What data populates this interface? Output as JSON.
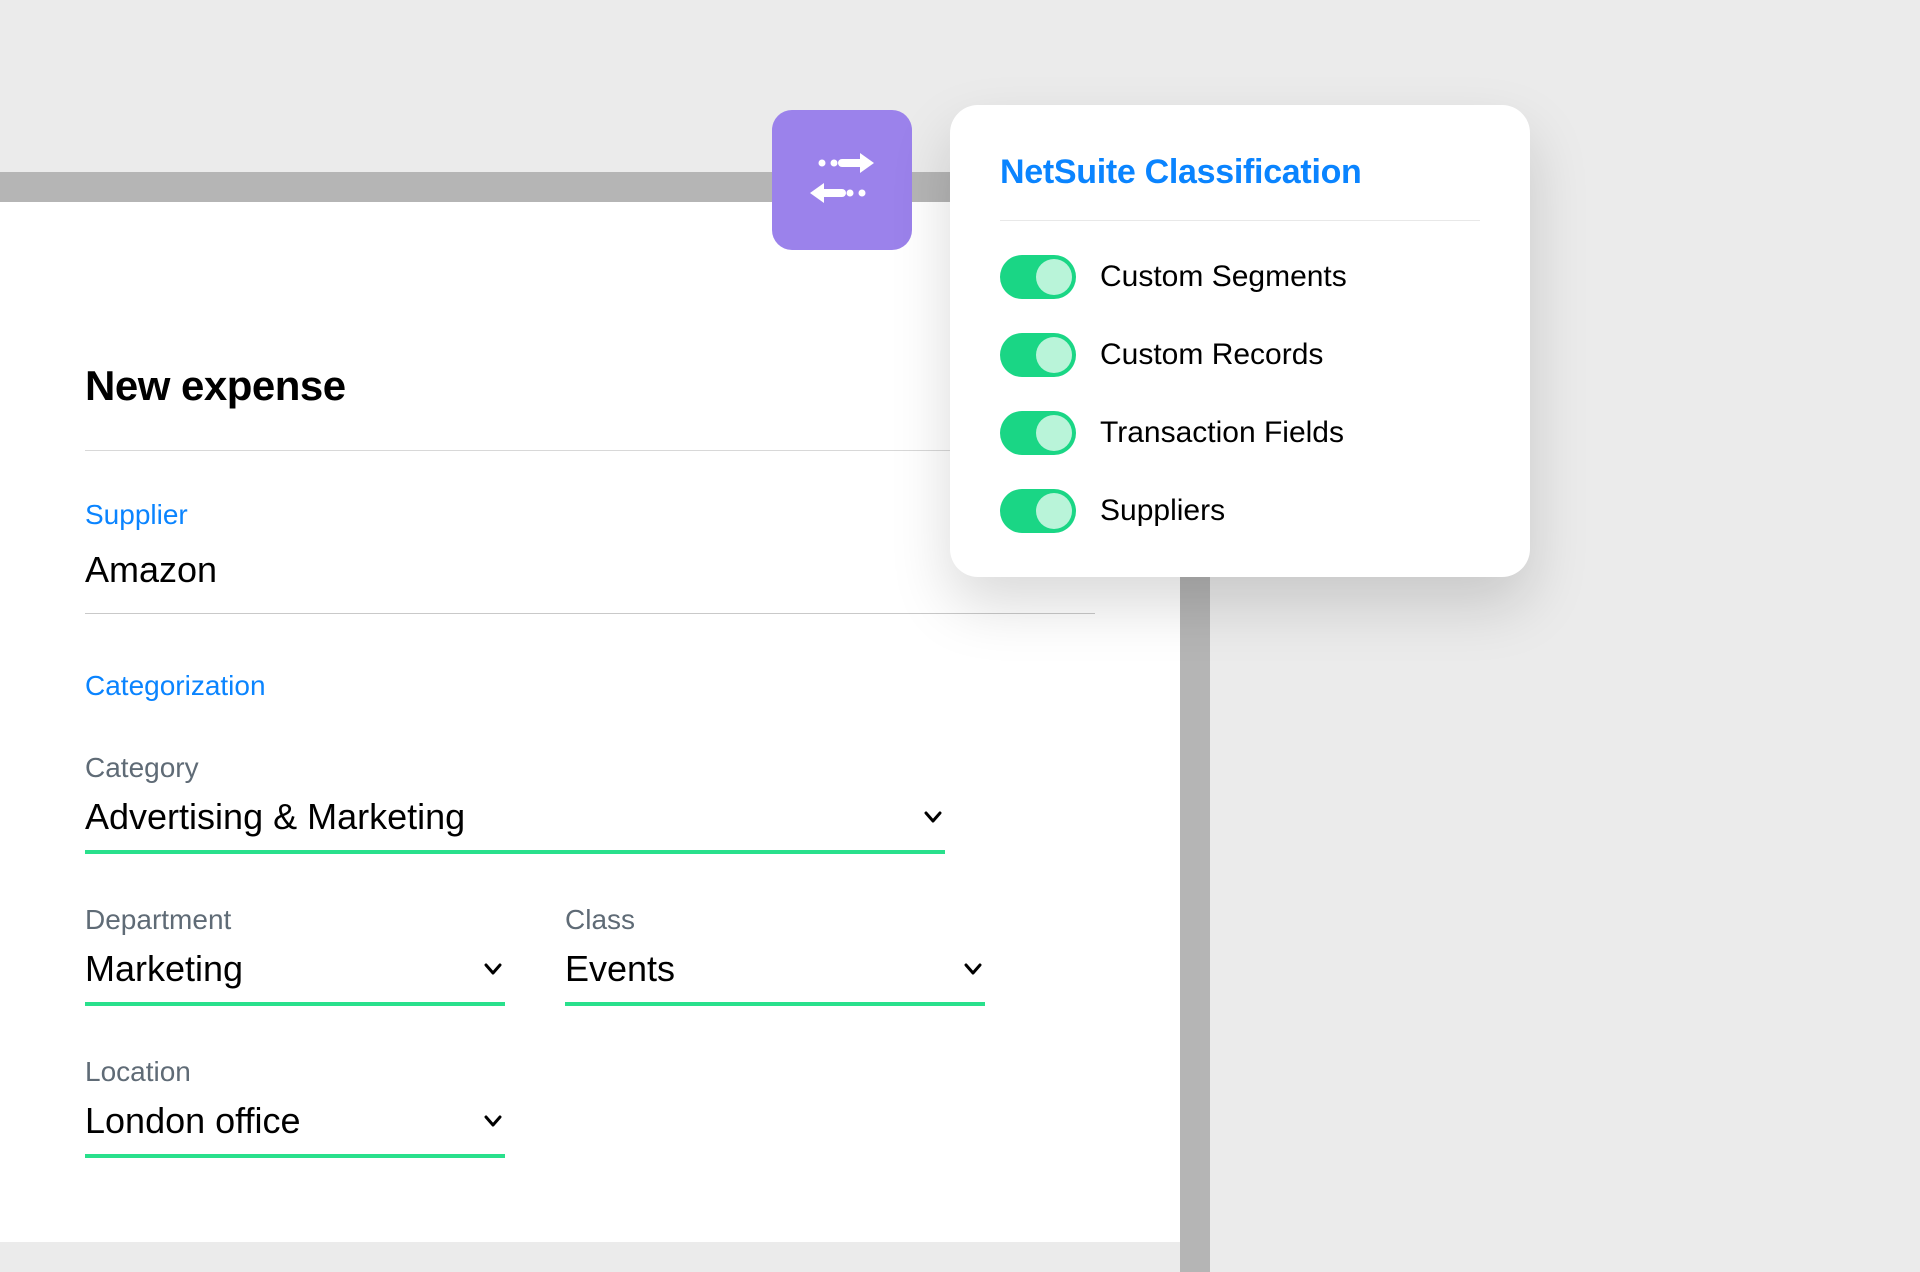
{
  "form": {
    "title": "New expense",
    "supplier_label": "Supplier",
    "supplier_value": "Amazon",
    "categorization_label": "Categorization",
    "fields": {
      "category": {
        "label": "Category",
        "value": "Advertising & Marketing"
      },
      "department": {
        "label": "Department",
        "value": "Marketing"
      },
      "class": {
        "label": "Class",
        "value": "Events"
      },
      "location": {
        "label": "Location",
        "value": "London office"
      }
    }
  },
  "popup": {
    "title": "NetSuite Classification",
    "toggles": [
      {
        "label": "Custom  Segments",
        "on": true
      },
      {
        "label": "Custom Records",
        "on": true
      },
      {
        "label": "Transaction Fields",
        "on": true
      },
      {
        "label": "Suppliers",
        "on": true
      }
    ]
  }
}
